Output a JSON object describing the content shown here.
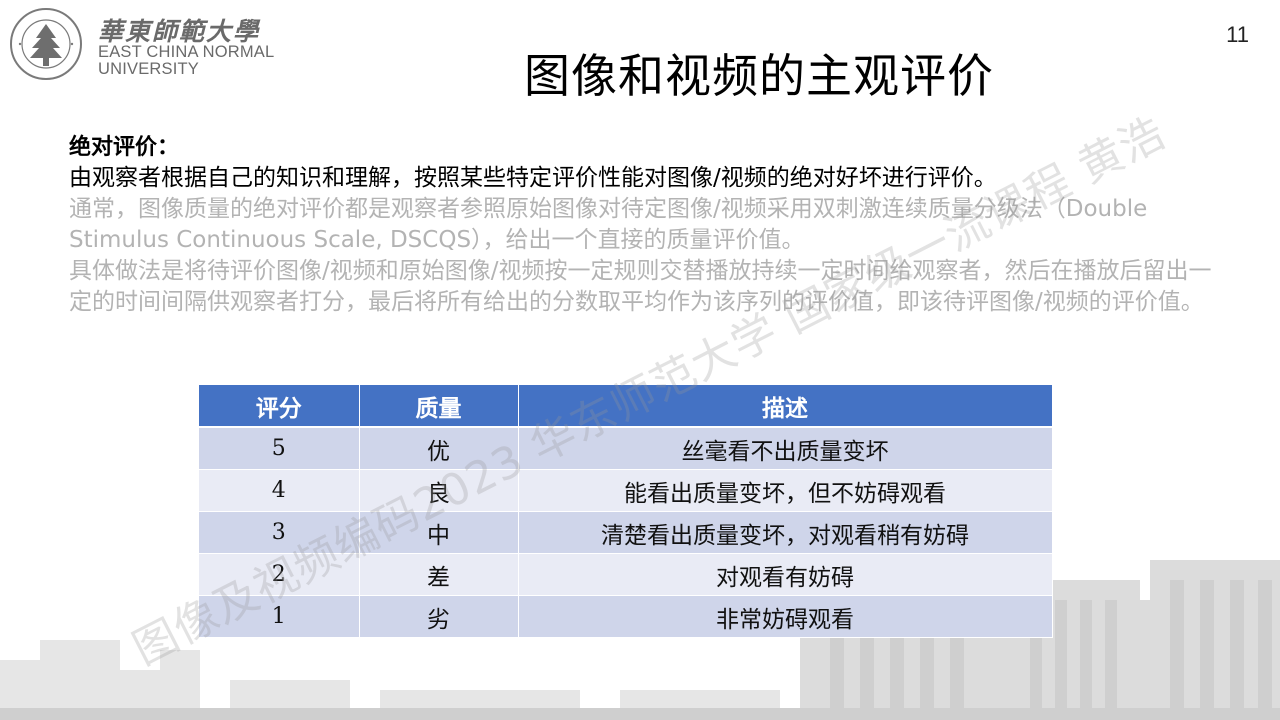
{
  "logo": {
    "chinese_name": "華東師範大學",
    "english_line1": "EAST CHINA NORMAL",
    "english_line2": "UNIVERSITY",
    "seal_text": "EAST CHINA NORMAL UNIVERSITY"
  },
  "page_number": "11",
  "title": "图像和视频的主观评价",
  "body": {
    "heading": "绝对评价：",
    "intro": "由观察者根据自己的知识和理解，按照某些特定评价性能对图像/视频的绝对好坏进行评价。",
    "paragraph1": "通常，图像质量的绝对评价都是观察者参照原始图像对待定图像/视频采用双刺激连续质量分级法（Double Stimulus Continuous Scale, DSCQS），给出一个直接的质量评价值。",
    "paragraph2": "具体做法是将待评价图像/视频和原始图像/视频按一定规则交替播放持续一定时间给观察者，然后在播放后留出一定的时间间隔供观察者打分，最后将所有给出的分数取平均作为该序列的评价值，即该待评图像/视频的评价值。"
  },
  "table": {
    "headers": [
      "评分",
      "质量",
      "描述"
    ],
    "rows": [
      {
        "score": "5",
        "quality": "优",
        "description": "丝毫看不出质量变坏"
      },
      {
        "score": "4",
        "quality": "良",
        "description": "能看出质量变坏，但不妨碍观看"
      },
      {
        "score": "3",
        "quality": "中",
        "description": "清楚看出质量变坏，对观看稍有妨碍"
      },
      {
        "score": "2",
        "quality": "差",
        "description": "对观看有妨碍"
      },
      {
        "score": "1",
        "quality": "劣",
        "description": "非常妨碍观看"
      }
    ]
  },
  "watermark": "图像及视频编码2023 华东师范大学 国家级一流课程 黄浩",
  "colors": {
    "header_blue": "#4472c4",
    "row_dark": "#cfd5ea",
    "row_light": "#e9ebf5",
    "muted_text": "#b3b3b3"
  }
}
